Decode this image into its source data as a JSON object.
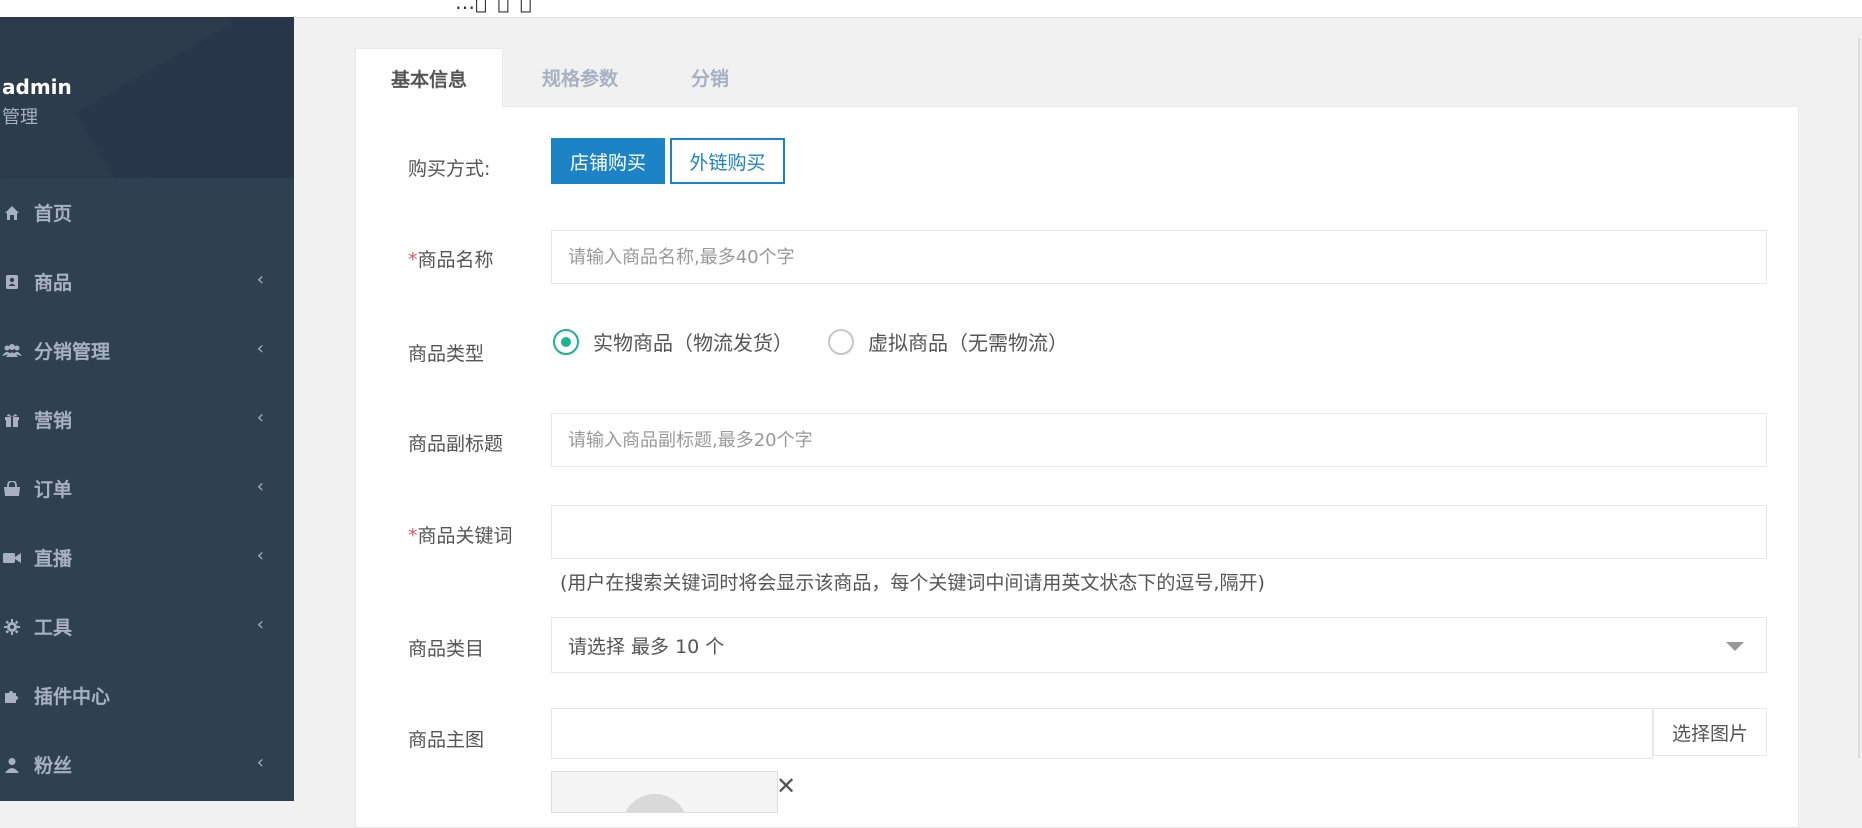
{
  "topbar": {
    "fragment": "…ﾟ ﾞ ﾞ"
  },
  "sidebar": {
    "user": {
      "name": "admin",
      "role": "管理"
    },
    "items": [
      {
        "label": "首页",
        "icon": "home-icon",
        "has_children": false
      },
      {
        "label": "商品",
        "icon": "contact-book-icon",
        "has_children": true
      },
      {
        "label": "分销管理",
        "icon": "users-icon",
        "has_children": true
      },
      {
        "label": "营销",
        "icon": "gift-icon",
        "has_children": true
      },
      {
        "label": "订单",
        "icon": "shopping-bag-icon",
        "has_children": true
      },
      {
        "label": "直播",
        "icon": "video-camera-icon",
        "has_children": true
      },
      {
        "label": "工具",
        "icon": "gear-icon",
        "has_children": true
      },
      {
        "label": "插件中心",
        "icon": "puzzle-icon",
        "has_children": false
      },
      {
        "label": "粉丝",
        "icon": "user-icon",
        "has_children": true
      }
    ],
    "chevron": "‹"
  },
  "tabs": [
    {
      "label": "基本信息",
      "active": true
    },
    {
      "label": "规格参数",
      "active": false
    },
    {
      "label": "分销",
      "active": false
    }
  ],
  "form": {
    "purchase_method": {
      "label": "购买方式:",
      "options": [
        "店铺购买",
        "外链购买"
      ],
      "selected": "店铺购买"
    },
    "product_name": {
      "required_mark": "*",
      "label": "商品名称",
      "value": "",
      "placeholder": "请输入商品名称,最多40个字"
    },
    "product_type": {
      "label": "商品类型",
      "options": [
        "实物商品（物流发货）",
        "虚拟商品（无需物流）"
      ],
      "selected": "实物商品（物流发货）"
    },
    "subtitle": {
      "label": "商品副标题",
      "value": "",
      "placeholder": "请输入商品副标题,最多20个字"
    },
    "keywords": {
      "required_mark": "*",
      "label": "商品关键词",
      "value": "",
      "hint": "(用户在搜索关键词时将会显示该商品，每个关键词中间请用英文状态下的逗号,隔开)"
    },
    "category": {
      "label": "商品类目",
      "value": "请选择 最多 10 个"
    },
    "main_image": {
      "label": "商品主图",
      "value": "",
      "button": "选择图片",
      "remove_icon": "close-icon"
    }
  },
  "colors": {
    "sidebar_bg": "#2f4050",
    "sidebar_text": "#a7b1c2",
    "primary": "#1c84c6",
    "radio_checked": "#1ab394",
    "required": "#ed5565"
  }
}
